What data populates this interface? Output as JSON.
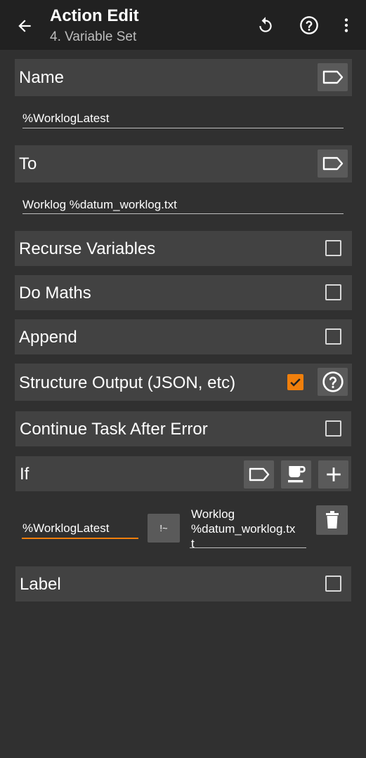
{
  "appbar": {
    "title": "Action Edit",
    "subtitle": "4. Variable Set",
    "icons": [
      "back-arrow-icon",
      "undo-icon",
      "help-icon",
      "more-vert-icon"
    ]
  },
  "fields": {
    "name_label": "Name",
    "name_value": "%WorklogLatest",
    "to_label": "To",
    "to_value": "Worklog %datum_worklog.txt"
  },
  "options": {
    "recurse_variables": {
      "label": "Recurse Variables",
      "checked": false
    },
    "do_maths": {
      "label": "Do Maths",
      "checked": false
    },
    "append": {
      "label": "Append",
      "checked": false
    },
    "structure_output": {
      "label": "Structure Output (JSON, etc)",
      "checked": true
    },
    "continue_after_error": {
      "label": "Continue Task After Error",
      "checked": false
    }
  },
  "condition": {
    "label": "If",
    "left_operand": "%WorklogLatest",
    "operator": "!~",
    "right_operand_line1": "Worklog",
    "right_operand_line2": "%datum_worklog.tx",
    "right_operand_line3": "t"
  },
  "label_option": {
    "label": "Label",
    "checked": false
  },
  "colors": {
    "background": "#303030",
    "appbar": "#212121",
    "row": "#424242",
    "accent": "#f07f0c"
  }
}
